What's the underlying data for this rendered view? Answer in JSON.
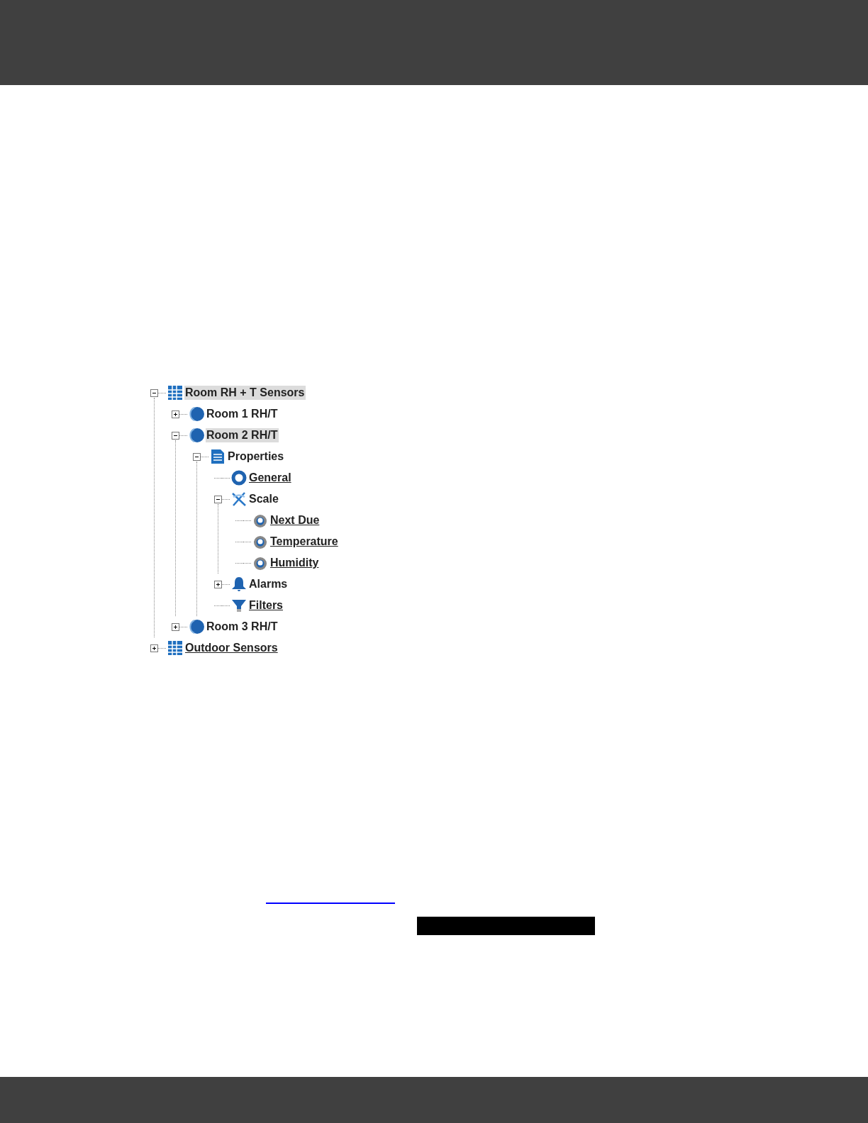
{
  "tree": [
    {
      "label": "Room RH + T Sensors",
      "kind": "grid",
      "expanded": true,
      "selected": true,
      "link": false,
      "children": [
        {
          "label": "Room 1 RH/T",
          "kind": "sensor",
          "expanded": false,
          "selected": false,
          "link": false
        },
        {
          "label": "Room 2 RH/T",
          "kind": "sensor",
          "expanded": true,
          "selected": true,
          "link": false,
          "children": [
            {
              "label": "Properties",
              "kind": "document",
              "expanded": true,
              "selected": false,
              "link": false,
              "children": [
                {
                  "label": "General",
                  "kind": "ring",
                  "selected": false,
                  "link": true
                },
                {
                  "label": "Scale",
                  "kind": "scale",
                  "expanded": true,
                  "selected": false,
                  "link": false,
                  "children": [
                    {
                      "label": "Next Due",
                      "kind": "gauge",
                      "selected": false,
                      "link": true
                    },
                    {
                      "label": "Temperature",
                      "kind": "gauge",
                      "selected": false,
                      "link": true
                    },
                    {
                      "label": "Humidity",
                      "kind": "gauge",
                      "selected": false,
                      "link": true
                    }
                  ]
                },
                {
                  "label": "Alarms",
                  "kind": "bell",
                  "expanded": false,
                  "selected": false,
                  "link": false
                },
                {
                  "label": "Filters",
                  "kind": "funnel",
                  "selected": false,
                  "link": true
                }
              ]
            }
          ]
        },
        {
          "label": "Room 3 RH/T",
          "kind": "sensor",
          "expanded": false,
          "selected": false,
          "link": false
        }
      ]
    },
    {
      "label": "Outdoor Sensors",
      "kind": "grid",
      "expanded": false,
      "selected": false,
      "link": true
    }
  ]
}
